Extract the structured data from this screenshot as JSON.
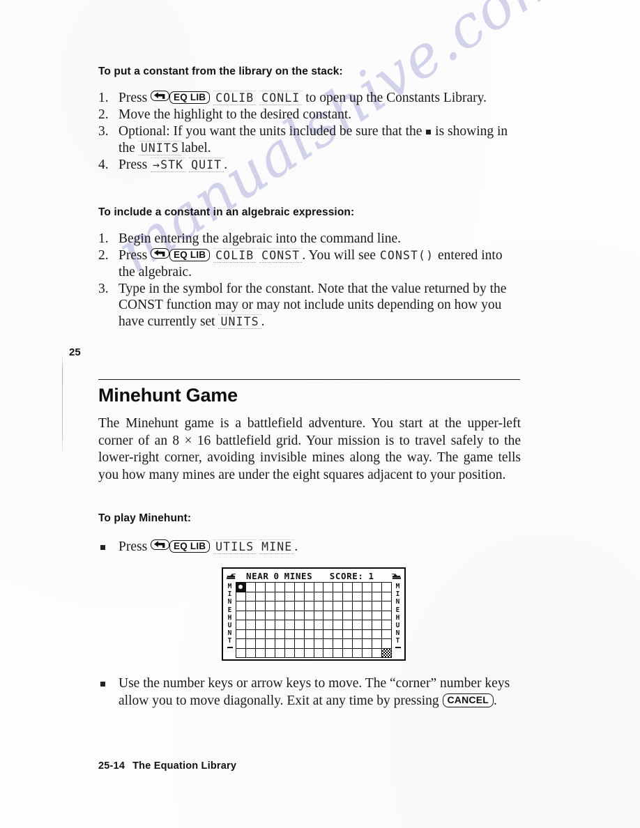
{
  "watermark": {
    "text": "manualshive.com"
  },
  "chapter_tab": {
    "number": "25"
  },
  "section_constants_stack": {
    "heading": "To put a constant from the library on the stack:",
    "steps": [
      {
        "num": "1.",
        "pre": "Press",
        "keys": [
          "left-shift",
          "EQ LIB"
        ],
        "softkeys": [
          "COLIB",
          "CONLI"
        ],
        "post": "to open up the Constants Library."
      },
      {
        "num": "2.",
        "text": "Move the highlight to the desired constant."
      },
      {
        "num": "3.",
        "pre": "Optional: If you want the units included be sure that the",
        "mid": "is showing in the",
        "softkeys": [
          "UNITS"
        ],
        "post": "label."
      },
      {
        "num": "4.",
        "pre": "Press",
        "softkeys": [
          "→STK",
          "QUIT"
        ],
        "post": "."
      }
    ]
  },
  "section_constants_algebraic": {
    "heading": "To include a constant in an algebraic expression:",
    "steps": [
      {
        "num": "1.",
        "text": "Begin entering the algebraic into the command line."
      },
      {
        "num": "2.",
        "pre": "Press",
        "keys": [
          "left-shift",
          "EQ LIB"
        ],
        "softkeys": [
          "COLIB",
          "CONST"
        ],
        "mid": ". You will see",
        "code": "CONST()",
        "post": "entered into the algebraic."
      },
      {
        "num": "3.",
        "pre": "Type in the symbol for the constant. Note that the value returned by the CONST function may or may not include units depending on how you have currently set",
        "softkeys": [
          "UNITS"
        ],
        "post": "."
      }
    ]
  },
  "minehunt": {
    "title": "Minehunt Game",
    "intro": "The Minehunt game is a battlefield adventure. You start at the upper-left corner of an 8 × 16 battlefield grid. Your mission is to travel safely to the lower-right corner, avoiding invisible mines along the way. The game tells you how many mines are under the eight squares adjacent to your position.",
    "play_heading": "To play Minehunt:",
    "play_step": {
      "pre": "Press",
      "keys": [
        "left-shift",
        "EQ LIB"
      ],
      "softkeys": [
        "UTILS",
        "MINE"
      ],
      "post": "."
    },
    "move_step": {
      "pre": "Use the number keys or arrow keys to move. The “corner” number keys allow you to move diagonally. Exit at any time by pressing",
      "key": "CANCEL",
      "post": "."
    }
  },
  "lcd": {
    "status_left_icon": "tank-icon",
    "status_right_icon": "tank-icon",
    "near_label": "NEAR",
    "near_count": "0",
    "mines_label": "MINES",
    "score_label": "SCORE:",
    "score_value": "1",
    "side_label_left": "MINEHUNT",
    "side_label_right": "MINEHUNT",
    "grid": {
      "cols": 16,
      "rows": 8,
      "player": {
        "row": 0,
        "col": 0
      },
      "goal": {
        "row": 7,
        "col": 15
      }
    }
  },
  "keycaps": {
    "left_shift": "left-arrow-hook",
    "eq_lib": "EQ LIB",
    "cancel": "CANCEL"
  },
  "footer": {
    "page": "25-14",
    "title": "The Equation Library"
  },
  "colors": {
    "ink": "#1a1a1a",
    "paper": "#fdfdfd",
    "watermark": "#c9c9e8"
  }
}
